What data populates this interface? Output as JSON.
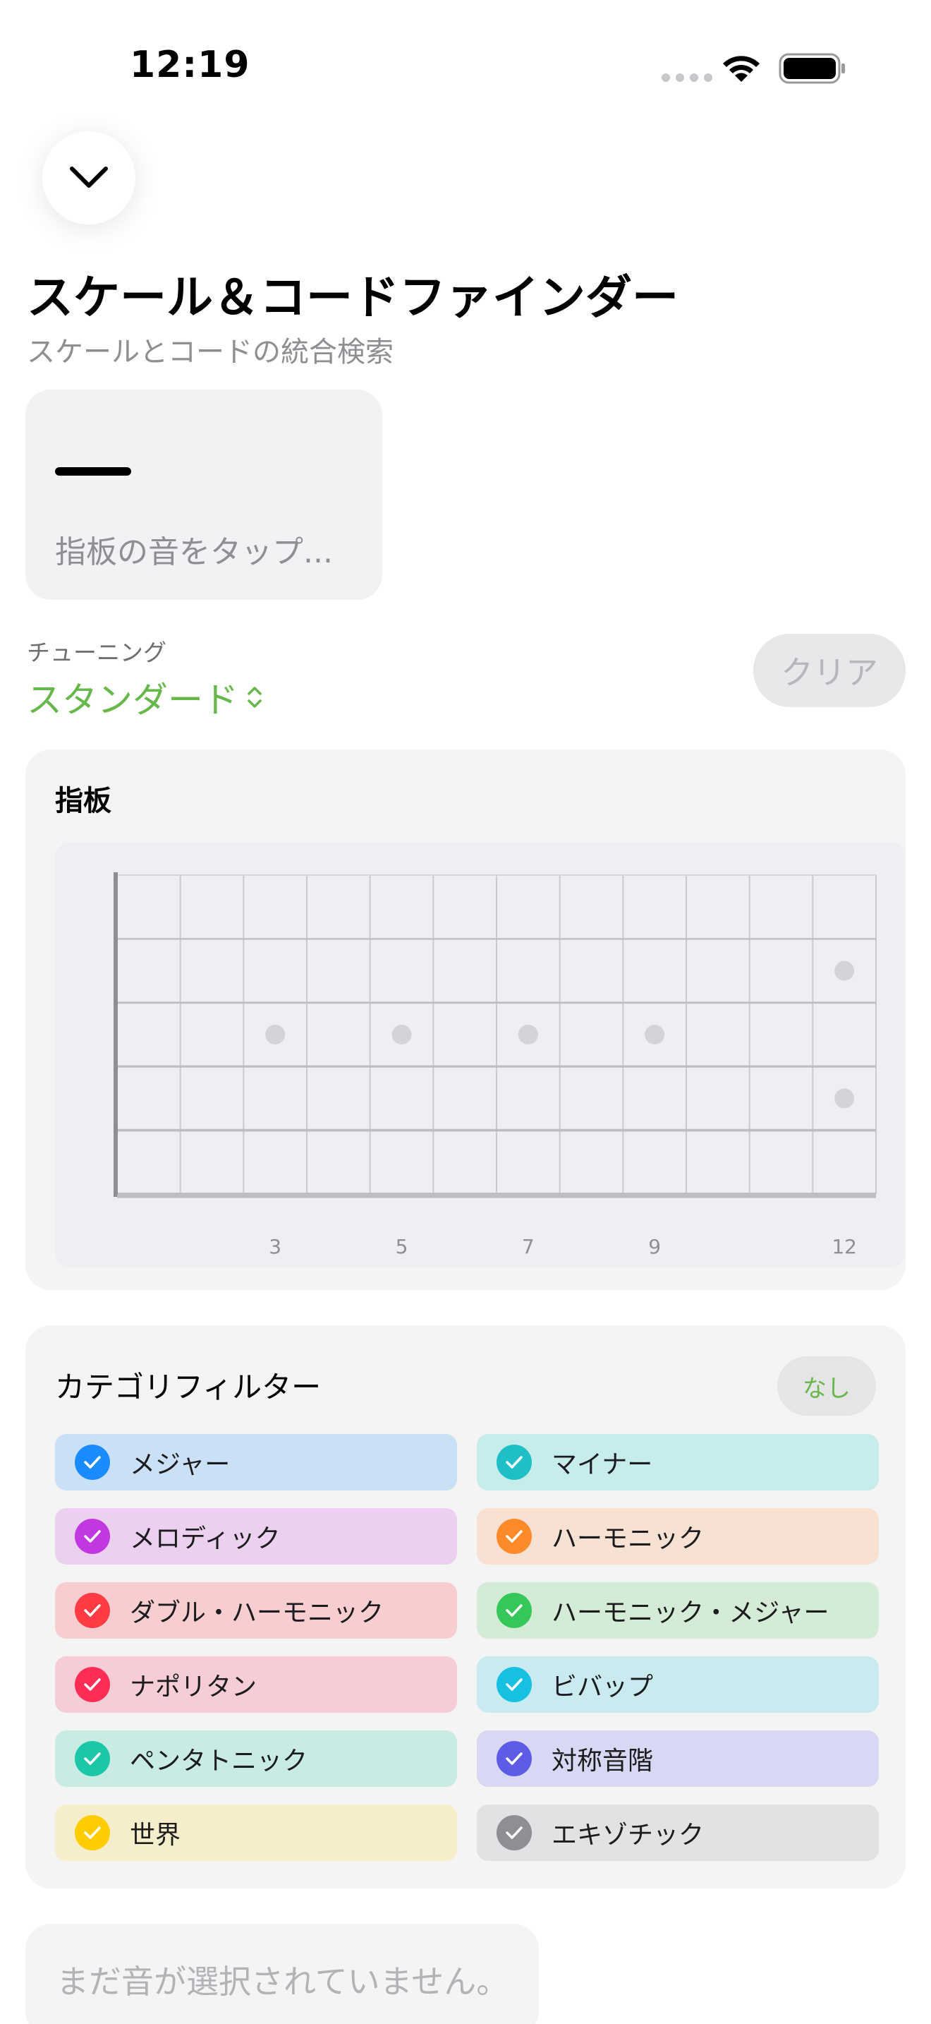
{
  "status_bar": {
    "time": "12:19"
  },
  "header": {
    "title": "スケール＆コードファインダー",
    "subtitle": "スケールとコードの統合検索"
  },
  "selected_notes": {
    "value": "—",
    "hint": "指板の音をタップ..."
  },
  "tuning": {
    "label": "チューニング",
    "value": "スタンダード"
  },
  "clear_label": "クリア",
  "fretboard": {
    "title": "指板",
    "fret_markers": [
      "3",
      "5",
      "7",
      "9",
      "12"
    ]
  },
  "filter": {
    "title": "カテゴリフィルター",
    "none_label": "なし",
    "categories": [
      {
        "label": "メジャー",
        "checked": true,
        "color": "#1a8cff",
        "bg": "#c9e0f6"
      },
      {
        "label": "マイナー",
        "checked": true,
        "color": "#1fbfc6",
        "bg": "#c6ecec"
      },
      {
        "label": "メロディック",
        "checked": true,
        "color": "#c238e0",
        "bg": "#ecd0ef"
      },
      {
        "label": "ハーモニック",
        "checked": true,
        "color": "#ff8a2a",
        "bg": "#f7e1d2"
      },
      {
        "label": "ダブル・ハーモニック",
        "checked": true,
        "color": "#ff3b44",
        "bg": "#f7cdd0"
      },
      {
        "label": "ハーモニック・メジャー",
        "checked": true,
        "color": "#35c759",
        "bg": "#d4ecd6"
      },
      {
        "label": "ナポリタン",
        "checked": true,
        "color": "#ff2d55",
        "bg": "#f6cdd6"
      },
      {
        "label": "ビバップ",
        "checked": true,
        "color": "#16c0e0",
        "bg": "#c9ebf0"
      },
      {
        "label": "ペンタトニック",
        "checked": true,
        "color": "#1cc7a8",
        "bg": "#c8ece4"
      },
      {
        "label": "対称音階",
        "checked": true,
        "color": "#5e5ce6",
        "bg": "#d8d8f4"
      },
      {
        "label": "世界",
        "checked": true,
        "color": "#ffcc00",
        "bg": "#f6edca"
      },
      {
        "label": "エキゾチック",
        "checked": true,
        "color": "#8e8e93",
        "bg": "#e2e2e4"
      }
    ]
  },
  "empty_state": "まだ音が選択されていません。"
}
